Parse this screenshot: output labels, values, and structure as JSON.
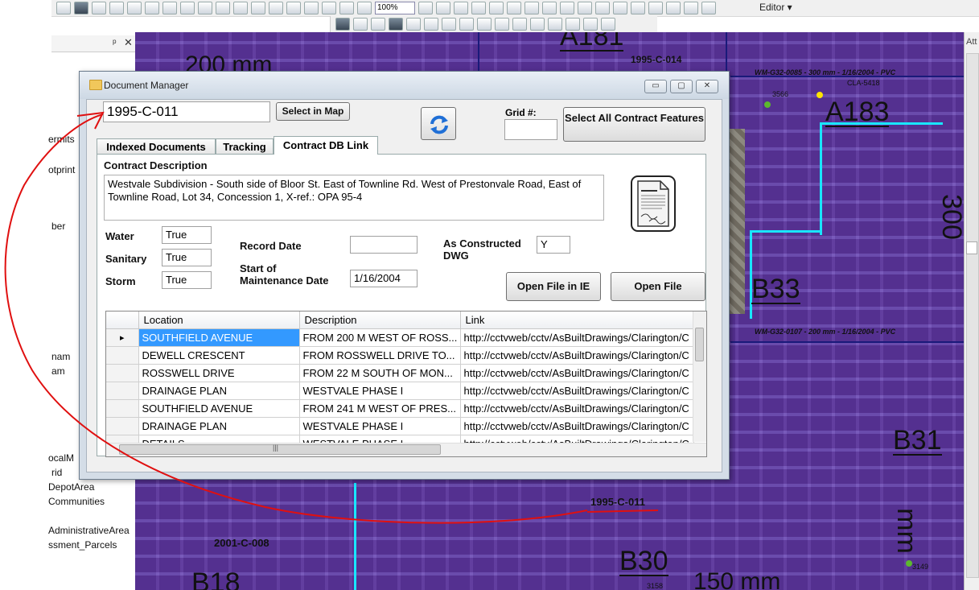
{
  "toolbar": {
    "editor_label": "Editor ▾",
    "zoom_value": "100%"
  },
  "toc": {
    "pin": "ᵖ",
    "close": "✕",
    "items": [
      "ermits",
      "otprint",
      "ber",
      "nam",
      "am",
      "ocalM",
      "rid",
      "DepotArea",
      "Communities",
      "AdministrativeArea",
      "ssment_Parcels"
    ]
  },
  "map": {
    "labels": {
      "pipe_top": "200 mm",
      "a181": "A181",
      "contract_top": "1995-C-014",
      "wm_top": "WM-G32-0085 - 300 mm - 1/16/2004 - PVC",
      "cla": "CLA-5418",
      "n3566": "3566",
      "a183": "A183",
      "right_vert": "300",
      "b33": "B33",
      "wm_mid": "WM-G32-0107 - 200 mm - 1/16/2004 - PVC",
      "b31": "B31",
      "contract_bottom": "1995-C-011",
      "contract_left": "2001-C-008",
      "mm_vert": "mm",
      "n3149": "3149",
      "b30": "B30",
      "n3158": "3158",
      "b18": "B18",
      "pipe_bottom": "150 mm"
    }
  },
  "right_panel": {
    "label": "Att"
  },
  "window": {
    "title": "Document Manager",
    "min_label": "▭",
    "max_label": "▢",
    "close_label": "✕",
    "contract_id": "1995-C-011",
    "select_in_map": "Select in Map",
    "grid_label": "Grid #:",
    "grid_value": "",
    "select_all": "Select All Contract Features",
    "tabs": [
      "Indexed Documents",
      "Tracking",
      "Contract DB Link"
    ],
    "active_tab": 2,
    "contract_description_label": "Contract Description",
    "contract_description": "Westvale Subdivision - South side of Bloor St. East of Townline Rd.  West of Prestonvale Road, East of Townline Road, Lot 34, Concession 1, X-ref.:  OPA 95-4",
    "water_label": "Water",
    "water_value": "True",
    "sanitary_label": "Sanitary",
    "sanitary_value": "True",
    "storm_label": "Storm",
    "storm_value": "True",
    "record_date_label": "Record Date",
    "record_date_value": "",
    "start_maint_label_1": "Start of",
    "start_maint_label_2": "Maintenance Date",
    "start_maint_value": "1/16/2004",
    "as_constructed_label_1": "As Constructed",
    "as_constructed_label_2": "DWG",
    "as_constructed_value": "Y",
    "open_ie": "Open File in IE",
    "open_file": "Open File",
    "table": {
      "columns": [
        "Location",
        "Description",
        "Link"
      ],
      "rows": [
        [
          "SOUTHFIELD AVENUE",
          "FROM 200 M WEST OF ROSS...",
          "http://cctvweb/cctv/AsBuiltDrawings/Clarington/C"
        ],
        [
          "DEWELL CRESCENT",
          "FROM ROSSWELL DRIVE TO...",
          "http://cctvweb/cctv/AsBuiltDrawings/Clarington/C"
        ],
        [
          "ROSSWELL DRIVE",
          "FROM 22 M SOUTH OF MON...",
          "http://cctvweb/cctv/AsBuiltDrawings/Clarington/C"
        ],
        [
          "DRAINAGE PLAN",
          "WESTVALE PHASE I",
          "http://cctvweb/cctv/AsBuiltDrawings/Clarington/C"
        ],
        [
          "SOUTHFIELD AVENUE",
          "FROM 241 M WEST OF PRES...",
          "http://cctvweb/cctv/AsBuiltDrawings/Clarington/C"
        ],
        [
          "DRAINAGE PLAN",
          "WESTVALE PHASE I",
          "http://cctvweb/cctv/AsBuiltDrawings/Clarington/C"
        ],
        [
          "DETAILS",
          "WESTVALE PHASE I",
          "http://cctvweb/cctv/AsBuiltDrawings/Clarington/C"
        ]
      ],
      "selected_row": 0,
      "row_indicator": "▸",
      "hscroll_grip": "|||"
    }
  },
  "colors": {
    "map_purple": "#6a4aa8",
    "selection_blue": "#3399ff",
    "annotation_red": "#e01010",
    "cyan_line": "#19e6ff"
  }
}
